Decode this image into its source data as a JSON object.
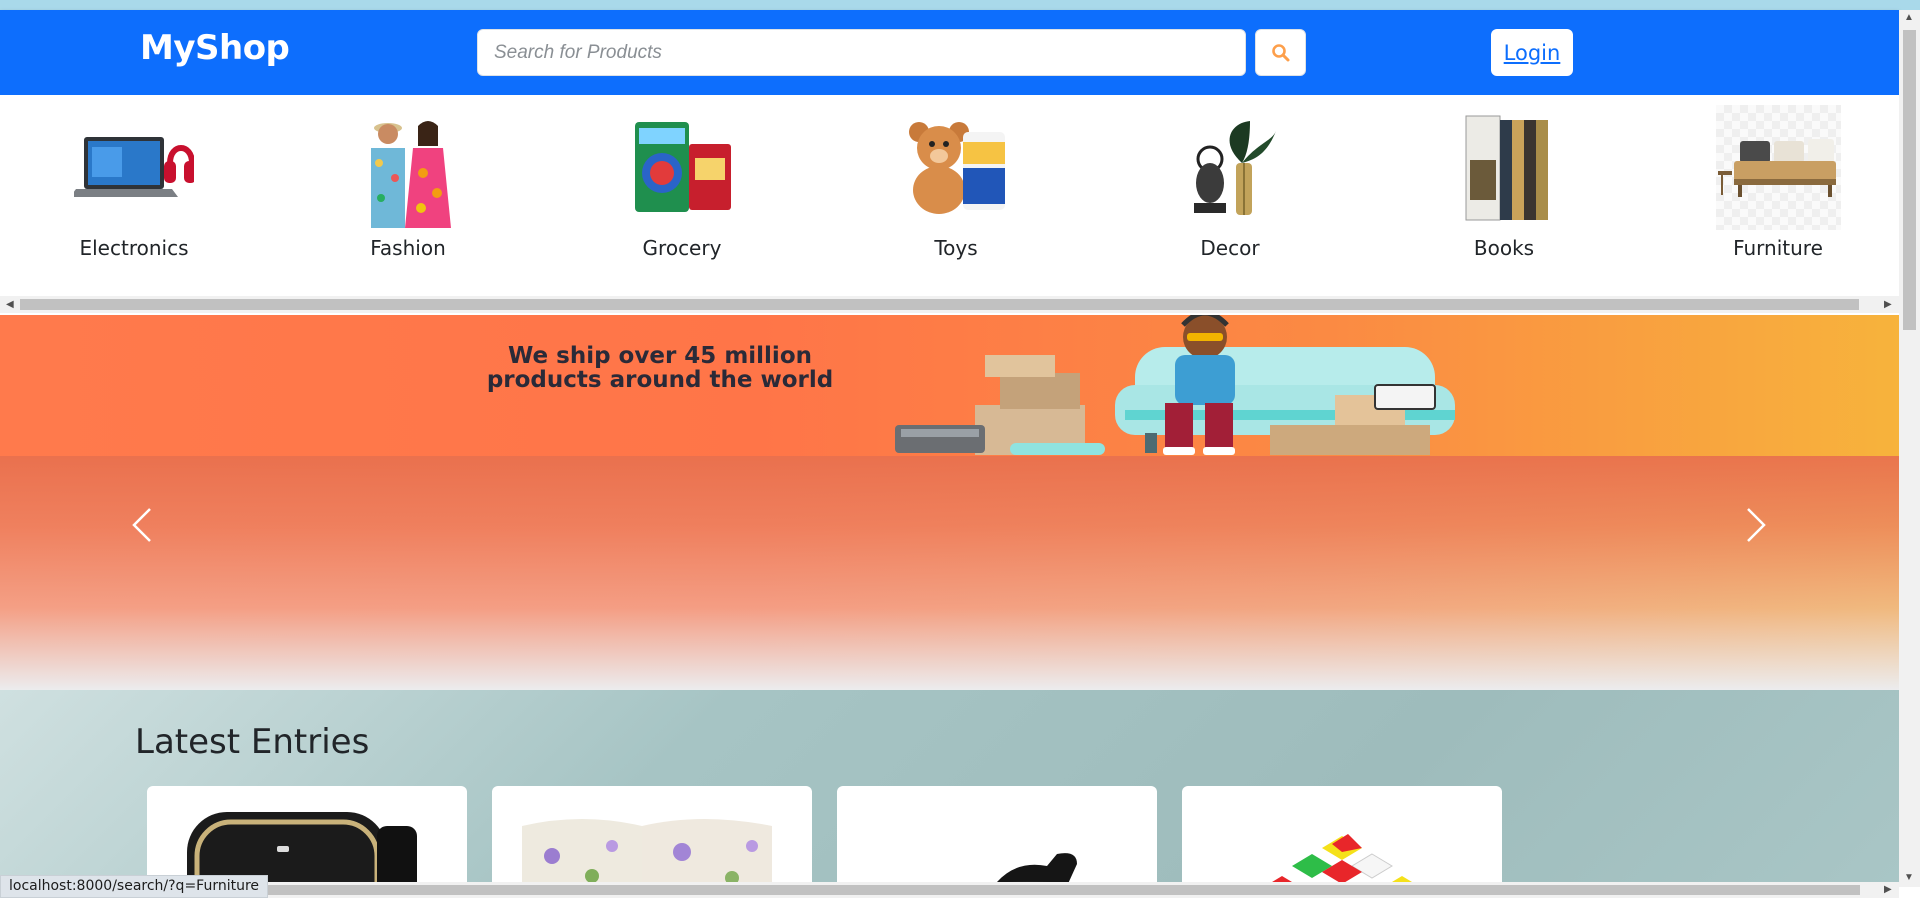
{
  "nav": {
    "brand": "MyShop",
    "search_placeholder": "Search for Products",
    "search_icon": "search-icon",
    "login_label": "Login",
    "bg_color": "#0d6efd",
    "search_icon_color": "#fd9f4b"
  },
  "categories": [
    {
      "label": "Electronics",
      "icon": "laptop-headphones-image"
    },
    {
      "label": "Fashion",
      "icon": "couple-fashion-image"
    },
    {
      "label": "Grocery",
      "icon": "detergent-tea-image"
    },
    {
      "label": "Toys",
      "icon": "teddy-bear-image"
    },
    {
      "label": "Decor",
      "icon": "plant-vase-image"
    },
    {
      "label": "Books",
      "icon": "books-set-image"
    },
    {
      "label": "Furniture",
      "icon": "sofa-image"
    }
  ],
  "hero": {
    "line1": "We ship over 45 million",
    "line2": "products around the world",
    "prev_icon": "chevron-left-icon",
    "next_icon": "chevron-right-icon"
  },
  "latest": {
    "title": "Latest Entries",
    "cards": [
      {
        "image": "smartwatch-image"
      },
      {
        "image": "bedsheet-image"
      },
      {
        "image": "shoe-image"
      },
      {
        "image": "cube-toy-image"
      }
    ]
  },
  "status": {
    "url": "localhost:8000/search/?q=Furniture"
  }
}
